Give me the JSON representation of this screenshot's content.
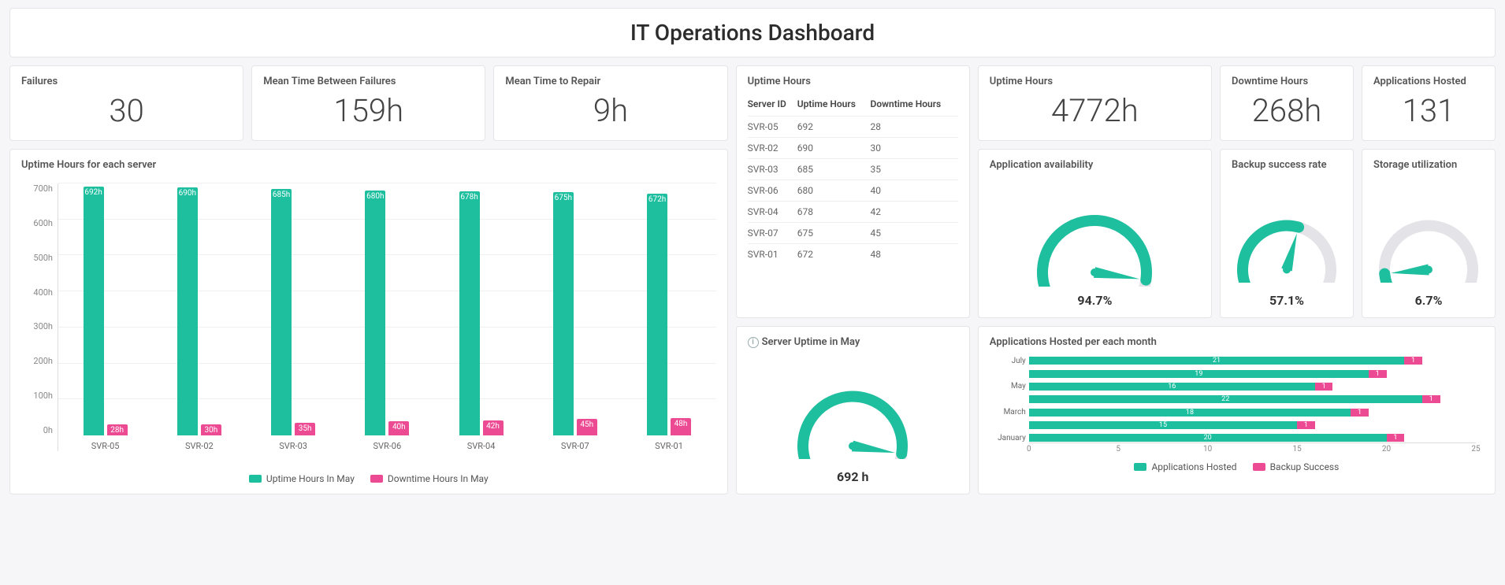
{
  "title": "IT Operations Dashboard",
  "kpis": {
    "failures_label": "Failures",
    "failures_value": "30",
    "mtbf_label": "Mean Time Between Failures",
    "mtbf_value": "159h",
    "mttr_label": "Mean Time to Repair",
    "mttr_value": "9h",
    "uptime_label": "Uptime Hours",
    "uptime_value": "4772h",
    "downtime_label": "Downtime Hours",
    "downtime_value": "268h",
    "apps_label": "Applications Hosted",
    "apps_value": "131"
  },
  "uptime_table": {
    "title": "Uptime Hours",
    "headers": {
      "server": "Server ID",
      "uptime": "Uptime Hours",
      "downtime": "Downtime Hours"
    },
    "rows": [
      {
        "server": "SVR-05",
        "uptime": "692",
        "downtime": "28"
      },
      {
        "server": "SVR-02",
        "uptime": "690",
        "downtime": "30"
      },
      {
        "server": "SVR-03",
        "uptime": "685",
        "downtime": "35"
      },
      {
        "server": "SVR-06",
        "uptime": "680",
        "downtime": "40"
      },
      {
        "server": "SVR-04",
        "uptime": "678",
        "downtime": "42"
      },
      {
        "server": "SVR-07",
        "uptime": "675",
        "downtime": "45"
      },
      {
        "server": "SVR-01",
        "uptime": "672",
        "downtime": "48"
      }
    ]
  },
  "gauges": {
    "app_avail": {
      "title": "Application availability",
      "value_text": "94.7%",
      "percent": 94.7
    },
    "backup": {
      "title": "Backup success rate",
      "value_text": "57.1%",
      "percent": 57.1
    },
    "storage": {
      "title": "Storage utilization",
      "value_text": "6.7%",
      "percent": 6.7
    },
    "server_uptime": {
      "title": "Server Uptime in May",
      "value_text": "692 h",
      "percent": 95
    }
  },
  "bar_chart": {
    "title": "Uptime Hours for each server",
    "legend": {
      "a": "Uptime Hours In May",
      "b": "Downtime Hours In May"
    }
  },
  "hbar_chart": {
    "title": "Applications Hosted per each month",
    "legend": {
      "a": "Applications Hosted",
      "b": "Backup Success"
    }
  },
  "chart_data": [
    {
      "type": "bar",
      "title": "Uptime Hours for each server",
      "categories": [
        "SVR-05",
        "SVR-02",
        "SVR-03",
        "SVR-06",
        "SVR-04",
        "SVR-07",
        "SVR-01"
      ],
      "series": [
        {
          "name": "Uptime Hours In May",
          "values": [
            692,
            690,
            685,
            680,
            678,
            675,
            672
          ],
          "labels": [
            "692h",
            "690h",
            "685h",
            "680h",
            "678h",
            "675h",
            "672h"
          ]
        },
        {
          "name": "Downtime Hours In May",
          "values": [
            28,
            30,
            35,
            40,
            42,
            45,
            48
          ],
          "labels": [
            "28h",
            "30h",
            "35h",
            "40h",
            "42h",
            "45h",
            "48h"
          ]
        }
      ],
      "ylim": [
        0,
        700
      ],
      "yticks": [
        "0h",
        "100h",
        "200h",
        "300h",
        "400h",
        "500h",
        "600h",
        "700h"
      ]
    },
    {
      "type": "bar",
      "orientation": "horizontal",
      "title": "Applications Hosted per each month",
      "categories": [
        "January",
        "March",
        "May",
        "July"
      ],
      "shown_labels": [
        "July",
        "May",
        "March",
        "January"
      ],
      "series": [
        {
          "name": "Applications Hosted",
          "values": [
            20,
            18,
            16,
            21
          ],
          "labels": [
            "20",
            "18",
            "16",
            "21"
          ]
        },
        {
          "name": "Applications Hosted 2",
          "values": [
            15,
            22,
            19,
            21
          ],
          "labels": [
            "15",
            "22",
            "19",
            "21"
          ]
        },
        {
          "name": "Backup Success",
          "values": [
            1,
            1,
            1,
            1
          ],
          "labels": [
            "1",
            "1",
            "1",
            "1"
          ]
        }
      ],
      "xlim": [
        0,
        25
      ],
      "xticks": [
        "0",
        "5",
        "10",
        "15",
        "20",
        "25"
      ]
    }
  ]
}
